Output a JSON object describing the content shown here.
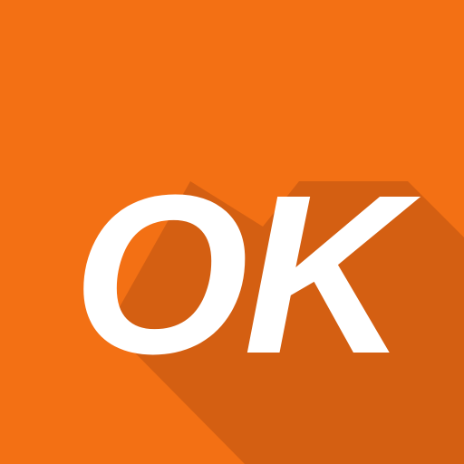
{
  "icon": {
    "text": "OK",
    "background_color": "#f37014",
    "shadow_color": "#c95a12",
    "text_color": "#ffffff"
  }
}
